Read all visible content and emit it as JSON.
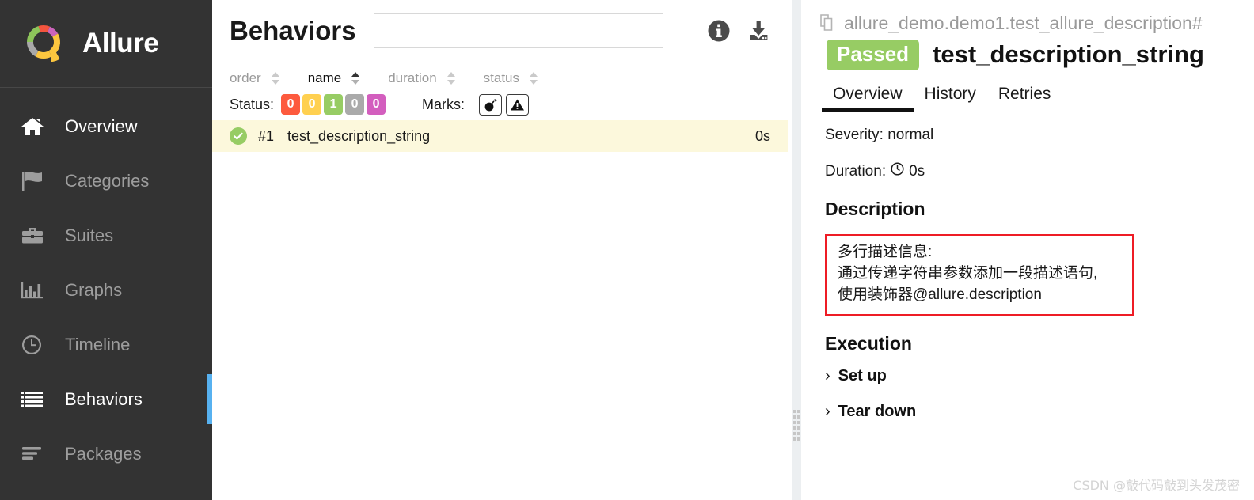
{
  "sidebar": {
    "brand": {
      "name": "Allure",
      "logo_icon": "allure-donut-logo"
    },
    "items": [
      {
        "label": "Overview",
        "icon": "home-icon"
      },
      {
        "label": "Categories",
        "icon": "flag-icon"
      },
      {
        "label": "Suites",
        "icon": "briefcase-icon"
      },
      {
        "label": "Graphs",
        "icon": "bar-chart-icon"
      },
      {
        "label": "Timeline",
        "icon": "clock-icon"
      },
      {
        "label": "Behaviors",
        "icon": "list-icon"
      },
      {
        "label": "Packages",
        "icon": "stack-icon"
      }
    ],
    "accent_color": "#57b1f0"
  },
  "list_panel": {
    "title": "Behaviors",
    "search": {
      "value": "",
      "placeholder": ""
    },
    "header_icons": [
      {
        "name": "info-icon"
      },
      {
        "name": "download-icon"
      }
    ],
    "sort_columns": [
      {
        "label": "order",
        "active": false
      },
      {
        "label": "name",
        "active": true
      },
      {
        "label": "duration",
        "active": false
      },
      {
        "label": "status",
        "active": false
      }
    ],
    "status_filter": {
      "label": "Status:",
      "badges": [
        {
          "count": "0",
          "status": "failed",
          "color": "#fd5a3e"
        },
        {
          "count": "0",
          "status": "broken",
          "color": "#ffd050"
        },
        {
          "count": "1",
          "status": "passed",
          "color": "#97cc64"
        },
        {
          "count": "0",
          "status": "skipped",
          "color": "#aaaaaa"
        },
        {
          "count": "0",
          "status": "unknown",
          "color": "#d35ebe"
        }
      ]
    },
    "marks_filter": {
      "label": "Marks:",
      "buttons": [
        {
          "name": "bomb-icon"
        },
        {
          "name": "warning-triangle-icon"
        }
      ]
    },
    "rows": [
      {
        "status": "passed",
        "order": "#1",
        "name": "test_description_string",
        "duration": "0s"
      }
    ]
  },
  "detail_panel": {
    "breadcrumb": "allure_demo.demo1.test_allure_description#",
    "breadcrumb_icon": "copy-icon",
    "status_badge": "Passed",
    "status_badge_color": "#97cc64",
    "title": "test_description_string",
    "tabs": [
      {
        "label": "Overview",
        "active": true
      },
      {
        "label": "History",
        "active": false
      },
      {
        "label": "Retries",
        "active": false
      }
    ],
    "severity": "Severity: normal",
    "duration_label": "Duration:",
    "duration_value": "0s",
    "description_heading": "Description",
    "description_lines": [
      "多行描述信息:",
      "通过传递字符串参数添加一段描述语句,",
      "使用装饰器@allure.description"
    ],
    "description_border_color": "#ee1c25",
    "execution_heading": "Execution",
    "execution_items": [
      {
        "label": "Set up"
      },
      {
        "label": "Tear down"
      }
    ]
  },
  "watermark": "CSDN @敲代码敲到头发茂密"
}
